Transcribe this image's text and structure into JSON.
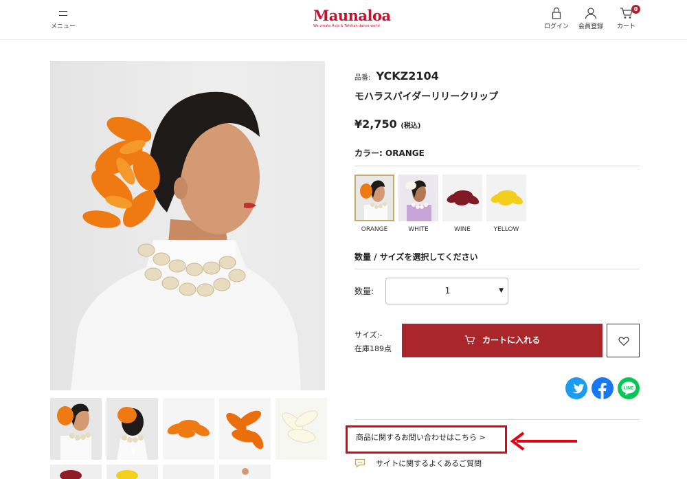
{
  "header": {
    "menu_label": "メニュー",
    "logo_text": "Maunaloa",
    "logo_tagline": "We create Hula & Tahitian dance world",
    "login_label": "ログイン",
    "register_label": "会員登録",
    "cart_label": "カート",
    "cart_count": "0"
  },
  "product": {
    "sku_label": "品番:",
    "sku": "YCKZ2104",
    "name": "モハラスパイダーリリークリップ",
    "price": "¥2,750",
    "price_tax": "(税込)",
    "color_label": "カラー:",
    "color_value": "ORANGE",
    "swatches": [
      {
        "label": "ORANGE",
        "selected": true
      },
      {
        "label": "WHITE",
        "selected": false
      },
      {
        "label": "WINE",
        "selected": false
      },
      {
        "label": "YELLOW",
        "selected": false
      }
    ],
    "select_heading": "数量 / サイズを選択してください",
    "qty_label": "数量:",
    "qty_value": "1",
    "size_line": "サイズ:-",
    "stock_line": "在庫189点",
    "cart_button": "カートに入れる",
    "inquiry_link": "商品に関するお問い合わせはこちら >",
    "faq_link": "サイトに関するよくあるご質問"
  },
  "colors": {
    "brand_red": "#c8102e",
    "cart_button": "#a9262b",
    "highlight": "#e3000f",
    "swatch_border": "#c5a96a"
  },
  "share_icons": [
    "twitter-icon",
    "facebook-icon",
    "line-icon"
  ]
}
